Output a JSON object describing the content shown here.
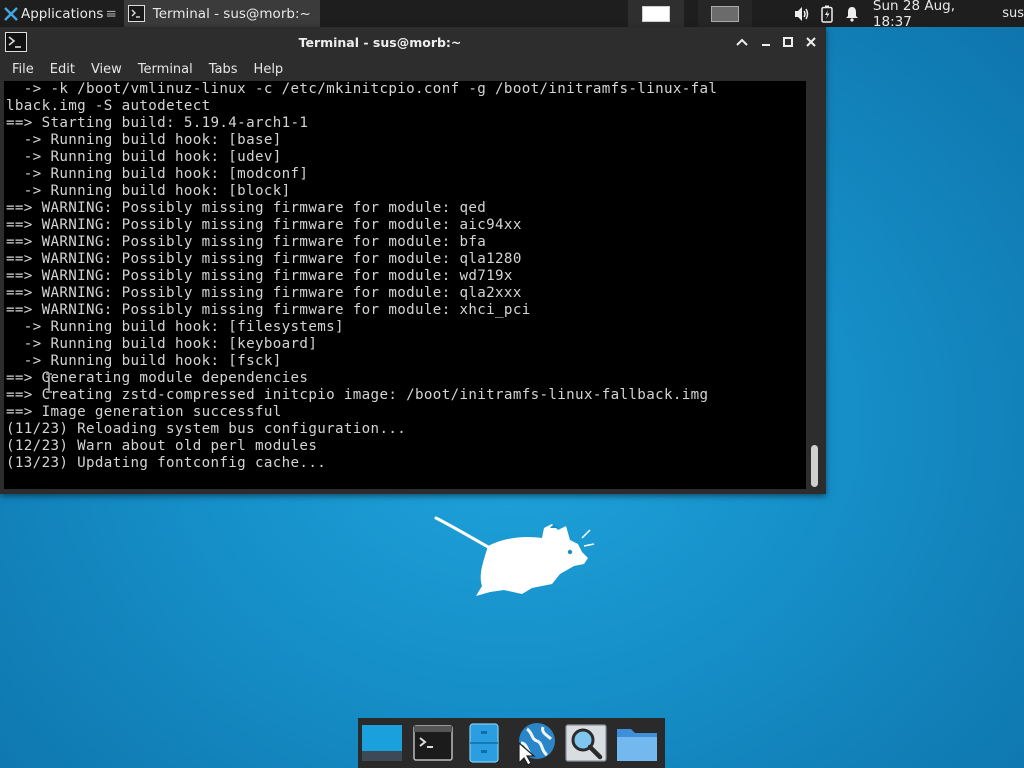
{
  "panel": {
    "applications_label": "Applications",
    "task_title": "Terminal - sus@morb:~",
    "clock": "Sun 28 Aug, 18:37",
    "user": "sus"
  },
  "window": {
    "title": "Terminal - sus@morb:~",
    "menu": [
      "File",
      "Edit",
      "View",
      "Terminal",
      "Tabs",
      "Help"
    ]
  },
  "terminal": {
    "lines": [
      "  -> -k /boot/vmlinuz-linux -c /etc/mkinitcpio.conf -g /boot/initramfs-linux-fal",
      "lback.img -S autodetect",
      "==> Starting build: 5.19.4-arch1-1",
      "  -> Running build hook: [base]",
      "  -> Running build hook: [udev]",
      "  -> Running build hook: [modconf]",
      "  -> Running build hook: [block]",
      "==> WARNING: Possibly missing firmware for module: qed",
      "==> WARNING: Possibly missing firmware for module: aic94xx",
      "==> WARNING: Possibly missing firmware for module: bfa",
      "==> WARNING: Possibly missing firmware for module: qla1280",
      "==> WARNING: Possibly missing firmware for module: wd719x",
      "==> WARNING: Possibly missing firmware for module: qla2xxx",
      "==> WARNING: Possibly missing firmware for module: xhci_pci",
      "  -> Running build hook: [filesystems]",
      "  -> Running build hook: [keyboard]",
      "  -> Running build hook: [fsck]",
      "==> Generating module dependencies",
      "==> Creating zstd-compressed initcpio image: /boot/initramfs-linux-fallback.img",
      "==> Image generation successful",
      "(11/23) Reloading system bus configuration...",
      "(12/23) Warn about old perl modules",
      "(13/23) Updating fontconfig cache..."
    ]
  },
  "icons": {
    "apps": "xfce-mouse-icon",
    "terminal": "terminal-icon",
    "desktop": "show-desktop-icon",
    "files": "file-manager-icon",
    "web": "web-browser-icon",
    "search": "app-finder-icon",
    "folder": "folder-icon"
  },
  "colors": {
    "desktop": "#168fc8",
    "panel": "#1e1e1e",
    "terminal_bg": "#000000",
    "terminal_fg": "#d4d4d4"
  }
}
